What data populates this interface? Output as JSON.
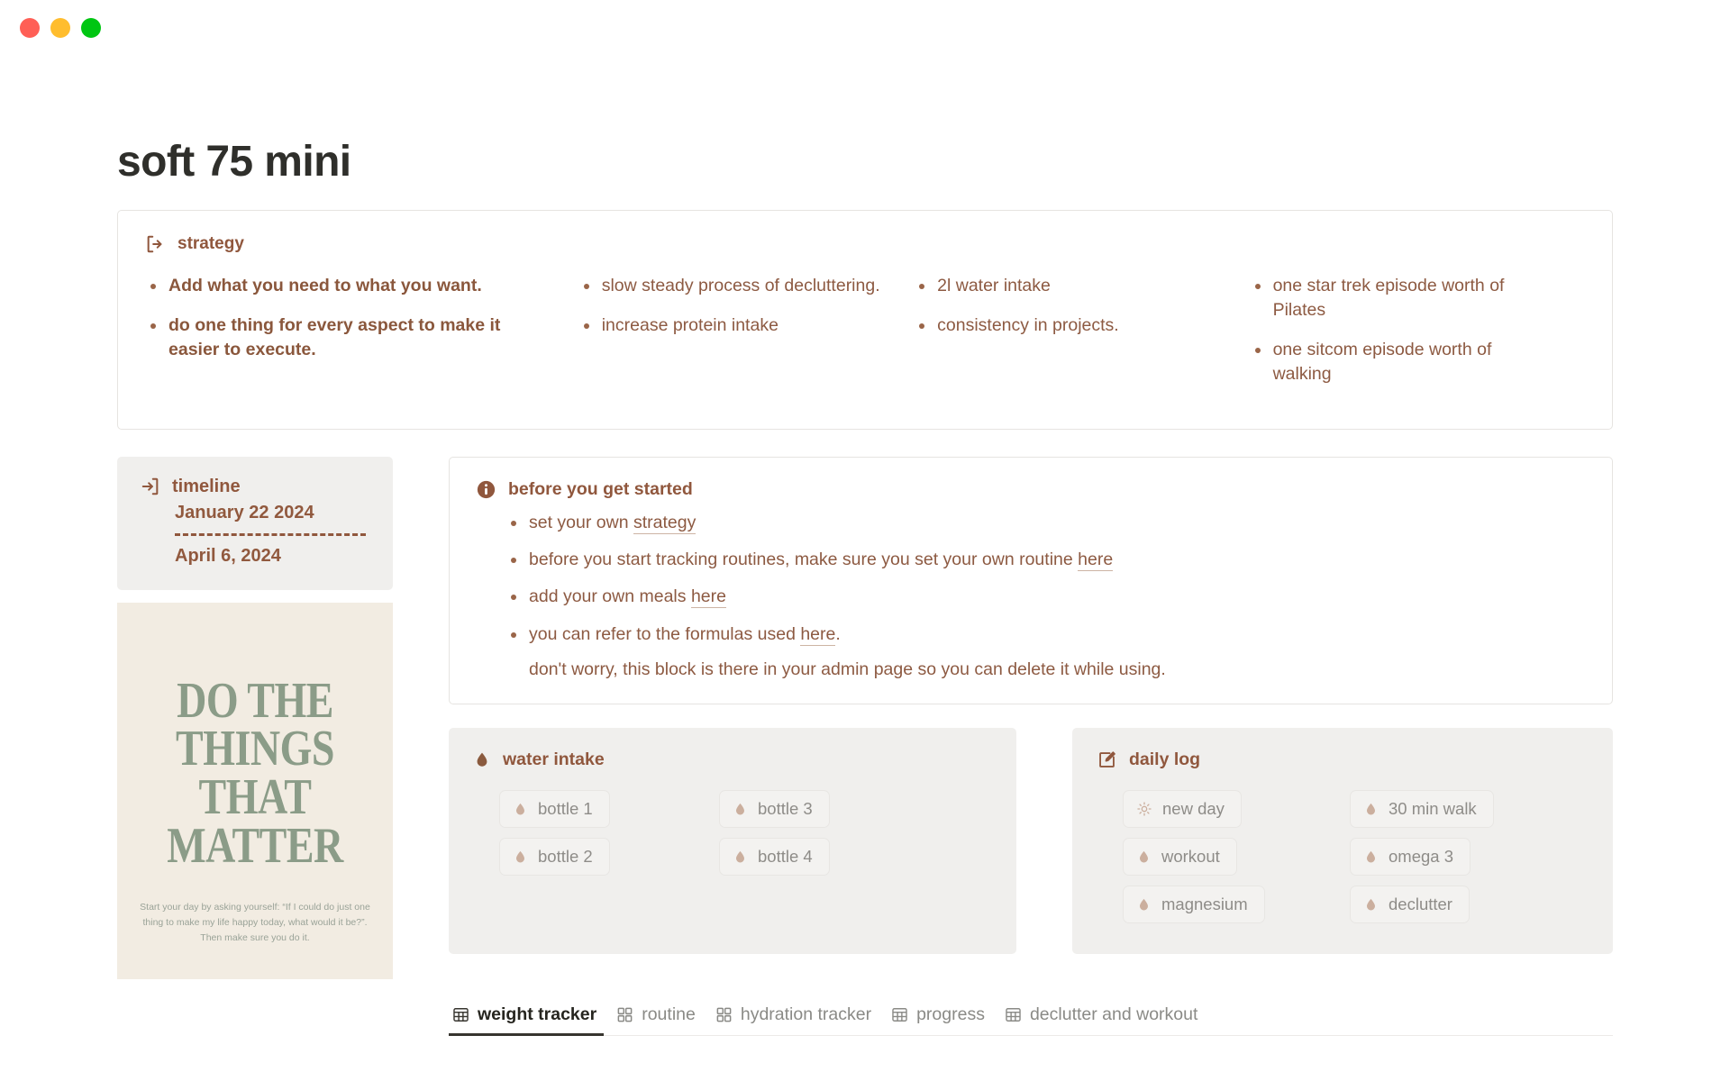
{
  "window": {
    "traffic_lights": [
      {
        "name": "close",
        "color": "#ff5f56"
      },
      {
        "name": "minimize",
        "color": "#ffbd2e"
      },
      {
        "name": "maximize",
        "color": "#00c612"
      }
    ]
  },
  "page": {
    "title": "soft 75 mini"
  },
  "strategy": {
    "icon": "logout-icon",
    "heading": "strategy",
    "columns": [
      {
        "bold": true,
        "items": [
          "Add what you need to what you want.",
          "do one thing for every aspect to make it easier to execute."
        ]
      },
      {
        "bold": false,
        "items": [
          "slow steady process of decluttering.",
          "increase protein intake"
        ]
      },
      {
        "bold": false,
        "items": [
          "2l water intake",
          "consistency in projects."
        ]
      },
      {
        "bold": false,
        "items": [
          "one star trek episode worth of Pilates",
          "one sitcom episode worth of walking"
        ]
      }
    ]
  },
  "timeline": {
    "icon": "login-icon",
    "heading": "timeline",
    "start_date": "January 22 2024",
    "end_date": "April 6, 2024"
  },
  "poster": {
    "lines": [
      "DO THE",
      "THINGS",
      "THAT",
      "MATTER"
    ],
    "subtext": "Start your day by asking yourself: “If I could do just one thing to make my life happy today, what would it be?”. Then make sure you do it.",
    "background": "#f2ece2",
    "text_color": "#8b9c88"
  },
  "before_started": {
    "icon": "info-icon",
    "heading": "before you get started",
    "items": [
      {
        "text_before": "set your own ",
        "link": "strategy",
        "text_after": ""
      },
      {
        "text_before": "before you start tracking routines, make sure you set your own routine ",
        "link": "here",
        "text_after": ""
      },
      {
        "text_before": "add your own meals ",
        "link": "here",
        "text_after": ""
      },
      {
        "text_before": "you can refer to the formulas used ",
        "link": "here",
        "text_after": "."
      }
    ],
    "note": "don't worry, this block is there in your admin page so you can delete it while using."
  },
  "water_intake": {
    "icon": "water-drop-icon",
    "heading": "water intake",
    "column_1": [
      {
        "icon": "water-drop-icon",
        "label": "bottle 1"
      },
      {
        "icon": "water-drop-icon",
        "label": "bottle 2"
      }
    ],
    "column_2": [
      {
        "icon": "water-drop-icon",
        "label": "bottle 3"
      },
      {
        "icon": "water-drop-icon",
        "label": "bottle 4"
      }
    ]
  },
  "daily_log": {
    "icon": "edit-square-icon",
    "heading": "daily log",
    "column_1": [
      {
        "icon": "sun-icon",
        "label": "new day"
      },
      {
        "icon": "water-drop-icon",
        "label": "workout"
      },
      {
        "icon": "water-drop-icon",
        "label": "magnesium"
      }
    ],
    "column_2": [
      {
        "icon": "water-drop-icon",
        "label": "30 min walk"
      },
      {
        "icon": "water-drop-icon",
        "label": "omega 3"
      },
      {
        "icon": "water-drop-icon",
        "label": "declutter"
      }
    ]
  },
  "tabs": [
    {
      "label": "weight tracker",
      "icon": "table-icon",
      "active": true
    },
    {
      "label": "routine",
      "icon": "gallery-icon",
      "active": false
    },
    {
      "label": "hydration tracker",
      "icon": "gallery-icon",
      "active": false
    },
    {
      "label": "progress",
      "icon": "table-icon",
      "active": false
    },
    {
      "label": "declutter and workout",
      "icon": "table-icon",
      "active": false
    }
  ],
  "colors": {
    "accent_brown": "#90573d",
    "text_brown": "#8d5a42",
    "panel_gray": "#f0efed",
    "chip_gray": "#8e8c88",
    "title_dark": "#2f2f2b"
  }
}
